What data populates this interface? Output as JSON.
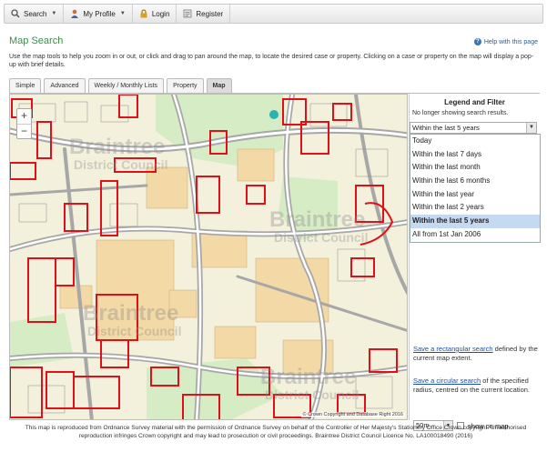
{
  "topbar": {
    "search": "Search",
    "profile": "My Profile",
    "login": "Login",
    "register": "Register"
  },
  "page": {
    "title": "Map Search",
    "help": "Help with this page",
    "intro": "Use the map tools to help you zoom in or out, or click and drag to pan around the map, to locate the desired case or property. Clicking on a case or property on the map will display a pop-up with brief details."
  },
  "tabs": [
    {
      "label": "Simple"
    },
    {
      "label": "Advanced"
    },
    {
      "label": "Weekly / Monthly Lists"
    },
    {
      "label": "Property"
    },
    {
      "label": "Map"
    }
  ],
  "map": {
    "zoom_in": "+",
    "zoom_out": "−",
    "watermark": "Braintree District Council",
    "watermark_line1": "Braintree",
    "watermark_line2": "District Council",
    "copyright": "© Crown Copyright and Database Right 2016",
    "colors": {
      "background": "#f3f0dc",
      "building": "#f2d9a6",
      "road": "#a7a7a7",
      "green": "#d6ecc5",
      "application": "#e0101a"
    }
  },
  "legend": {
    "title": "Legend and Filter",
    "note": "No longer showing search results.",
    "select_value": "Within the last 5 years",
    "options": [
      "Today",
      "Within the last 7 days",
      "Within the last month",
      "Within the last 6 months",
      "Within the last year",
      "Within the last 2 years",
      "Within the last 5 years",
      "All from 1st Jan 2006"
    ],
    "selected_index": 6,
    "rect_link": "Save a rectangular search",
    "rect_text": " defined by the current map extent.",
    "circ_link": "Save a circular search",
    "circ_text": " of the specified radius, centred on the current location.",
    "radius_value": "50m",
    "show_on_map": "show on map"
  },
  "footnote": "This map is reproduced from Ordnance Survey material with the permission of Ordnance Survey on behalf of the Controller of Her Majesty's Stationery Office Crown copyright. Unauthorised reproduction infringes Crown copyright and may lead to prosecution or civil proceedings. Braintree District Council Licence No. LA100018490 (2016)"
}
